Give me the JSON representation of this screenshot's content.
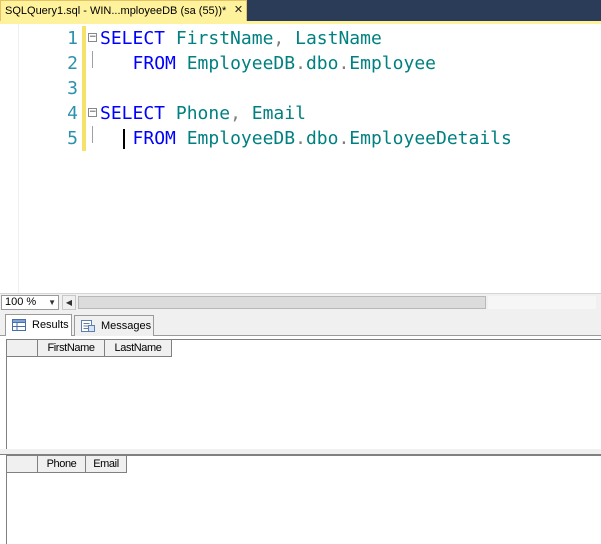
{
  "document_tab": {
    "title": "SQLQuery1.sql - WIN...mployeeDB (sa (55))*",
    "close_glyph": "✕"
  },
  "editor": {
    "lines": [
      {
        "num": "1",
        "fold": "−",
        "segments": [
          {
            "t": "SELECT",
            "c": "kw"
          },
          {
            "t": " ",
            "c": "pn"
          },
          {
            "t": "FirstName",
            "c": "id"
          },
          {
            "t": ",",
            "c": "pn"
          },
          {
            "t": " ",
            "c": "pn"
          },
          {
            "t": "LastName",
            "c": "id"
          }
        ]
      },
      {
        "num": "2",
        "fold": "",
        "segments": [
          {
            "t": "   ",
            "c": "pn"
          },
          {
            "t": "FROM",
            "c": "kw"
          },
          {
            "t": " ",
            "c": "pn"
          },
          {
            "t": "EmployeeDB",
            "c": "id"
          },
          {
            "t": ".",
            "c": "pn"
          },
          {
            "t": "dbo",
            "c": "id"
          },
          {
            "t": ".",
            "c": "pn"
          },
          {
            "t": "Employee",
            "c": "id"
          }
        ]
      },
      {
        "num": "3",
        "fold": "",
        "segments": []
      },
      {
        "num": "4",
        "fold": "−",
        "segments": [
          {
            "t": "SELECT",
            "c": "kw"
          },
          {
            "t": " ",
            "c": "pn"
          },
          {
            "t": "Phone",
            "c": "id"
          },
          {
            "t": ",",
            "c": "pn"
          },
          {
            "t": " ",
            "c": "pn"
          },
          {
            "t": "Email",
            "c": "id"
          }
        ]
      },
      {
        "num": "5",
        "fold": "",
        "segments": [
          {
            "t": "   ",
            "c": "pn"
          },
          {
            "t": "FROM",
            "c": "kw"
          },
          {
            "t": " ",
            "c": "pn"
          },
          {
            "t": "EmployeeDB",
            "c": "id"
          },
          {
            "t": ".",
            "c": "pn"
          },
          {
            "t": "dbo",
            "c": "id"
          },
          {
            "t": ".",
            "c": "pn"
          },
          {
            "t": "EmployeeDetails",
            "c": "id"
          }
        ]
      }
    ],
    "syntax_colors": {
      "keyword": "#0000ff",
      "identifier": "#008080",
      "punctuation": "#808080",
      "line_number": "#2b91af"
    }
  },
  "status": {
    "zoom": "100 %"
  },
  "results_tabs": [
    {
      "label": "Results",
      "icon": "results-grid-icon",
      "active": true
    },
    {
      "label": "Messages",
      "icon": "messages-icon",
      "active": false
    }
  ],
  "result_grids": [
    {
      "columns": [
        "FirstName",
        "LastName"
      ]
    },
    {
      "columns": [
        "Phone",
        "Email"
      ]
    }
  ]
}
